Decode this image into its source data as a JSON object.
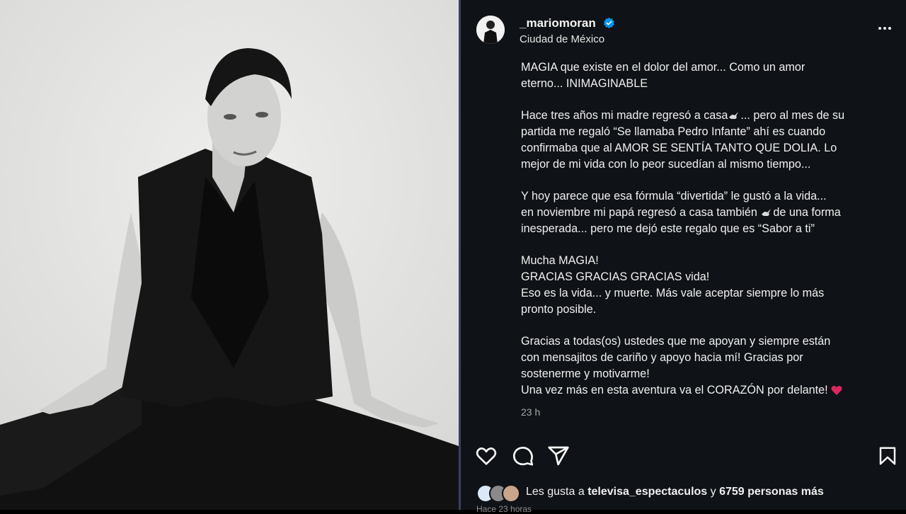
{
  "post": {
    "username": "_mariomoran",
    "location": "Ciudad de México",
    "caption_lines": [
      [
        "MAGIA que existe en el dolor del amor... Como un amor",
        "eterno... INIMAGINABLE"
      ],
      [
        "Hace tres años mi madre regresó a casa",
        "partida me regaló “Se llamaba Pedro Infante” ahí es cuando",
        "confirmaba que al AMOR SE SENTÍA TANTO QUE DOLIA. Lo",
        "mejor de mi vida con lo peor sucedían al mismo tiempo..."
      ],
      [
        "Y hoy parece que esa fórmula “divertida” le gustó a la vida...",
        "en noviembre mi papá regresó a casa también ",
        "inesperada... pero me dejó este regalo que es “Sabor a ti”"
      ],
      [
        "Mucha MAGIA!",
        "GRACIAS GRACIAS GRACIAS vida!",
        "Eso es la vida... y muerte. Más vale aceptar siempre lo más",
        "pronto posible."
      ],
      [
        "Gracias a todas(os) ustedes que me apoyan y siempre están",
        "con mensajitos de cariño y apoyo hacia mí! Gracias por",
        "sostenerme y motivarme!",
        "Una vez más en esta aventura va el CORAZÓN por delante!"
      ]
    ],
    "caption_inline": {
      "after_dove_1": "... pero al mes de su",
      "after_dove_2": "de una forma"
    },
    "time_ago": "23 h",
    "likes": {
      "prefix": "Les gusta a",
      "user": "televisa_espectaculos",
      "conj": "y",
      "others": "6759 personas más"
    },
    "posted_ago": "Hace 23 horas"
  },
  "icons": [
    "verified-badge-icon",
    "more-options-icon",
    "heart-icon",
    "comment-icon",
    "share-icon",
    "bookmark-icon",
    "dove-emoji-icon",
    "heart-emoji-icon"
  ],
  "colors": {
    "panel_bg": "#0f1216",
    "verified": "#0095f6",
    "text": "#f5f5f5",
    "muted": "#a8a8a8"
  }
}
